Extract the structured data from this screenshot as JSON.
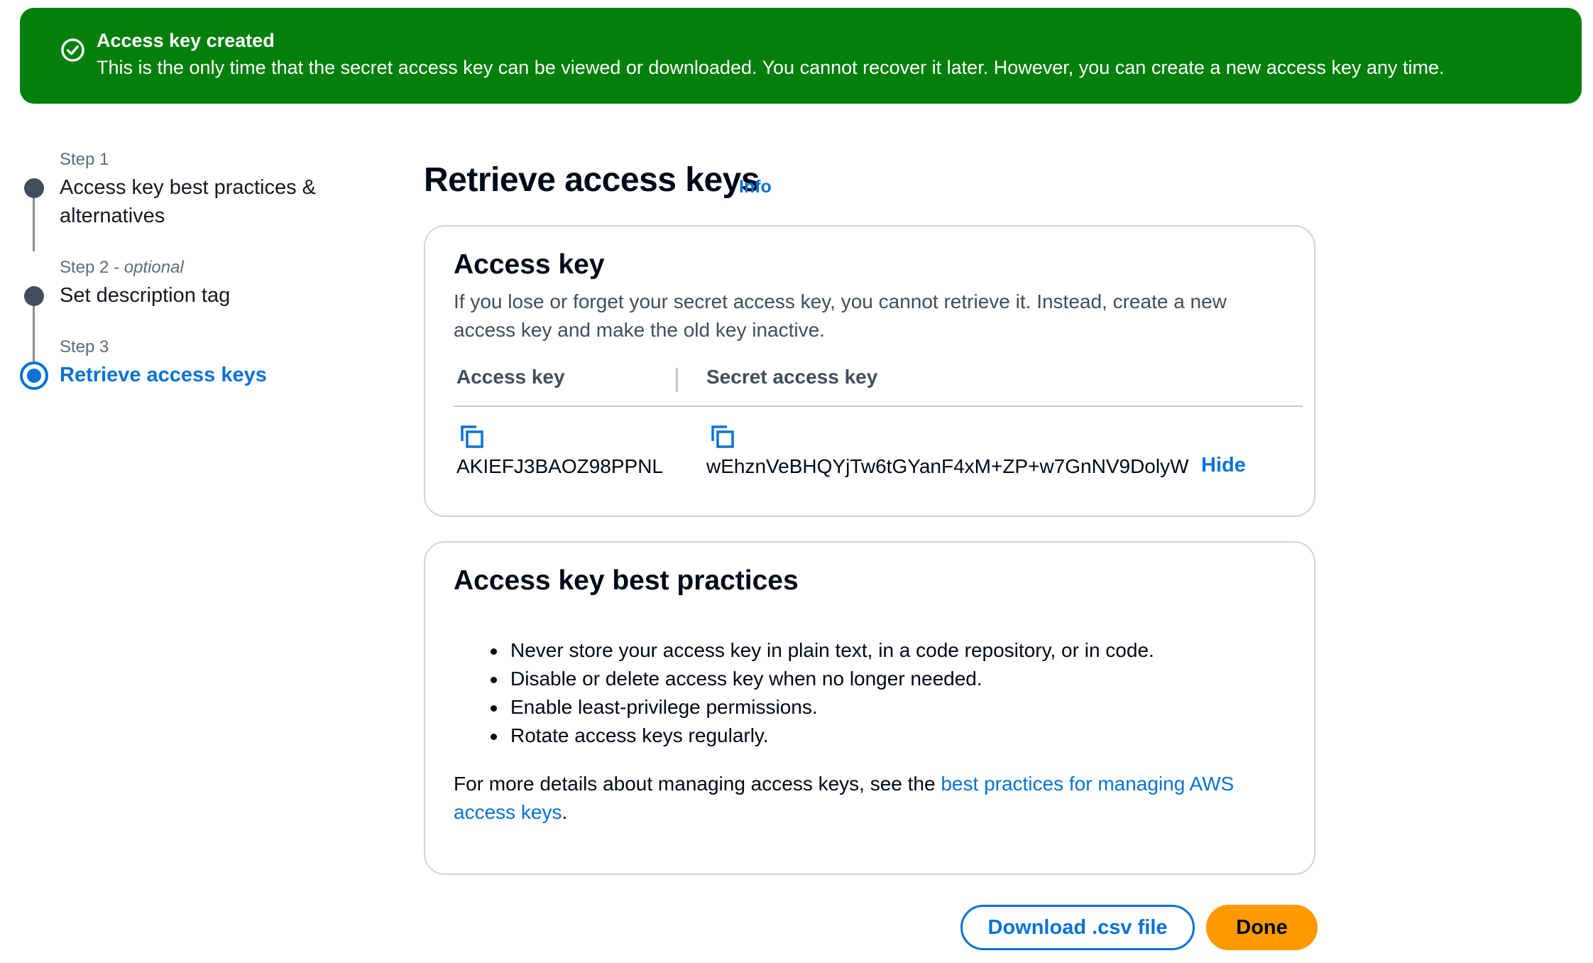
{
  "flash": {
    "icon": "check-circle-icon",
    "title": "Access key created",
    "message": "This is the only time that the secret access key can be viewed or downloaded. You cannot recover it later. However, you can create a new access key any time.",
    "color": "#037f0c"
  },
  "steps": [
    {
      "number": "Step 1",
      "optional": "",
      "title_line1": "Access key best practices &",
      "title_line2": "alternatives"
    },
    {
      "number": "Step 2",
      "optional": " - optional",
      "title_line1": "Set description tag"
    },
    {
      "number": "Step 3",
      "optional": "",
      "title_line1": "Retrieve access keys",
      "current": true
    }
  ],
  "header": {
    "title": "Retrieve access keys",
    "info_link": "Info"
  },
  "access_key_panel": {
    "title": "Access key",
    "description": "If you lose or forget your secret access key, you cannot retrieve it. Instead, create a new access key and make the old key inactive.",
    "columns": [
      "Access key",
      "Secret access key"
    ],
    "access_key_value": "AKIEFJ3BAOZ98PPNL",
    "secret_key_value": "wEhznVeBHQYjTw6tGYanF4xM+ZP+w7GnNV9DolyW",
    "hide_label": "Hide",
    "copy_icon": "copy-icon"
  },
  "best_practices": {
    "title": "Access key best practices",
    "items": [
      "Never store your access key in plain text, in a code repository, or in code.",
      "Disable or delete access key when no longer needed.",
      "Enable least-privilege permissions.",
      "Rotate access keys regularly."
    ],
    "footer_prefix": "For more details about managing access keys, see the ",
    "footer_link": "best practices for managing AWS access keys",
    "footer_suffix": "."
  },
  "actions": {
    "download_label": "Download .csv file",
    "done_label": "Done"
  },
  "colors": {
    "accent": "#0972d3",
    "primary_button": "#ff9900",
    "success": "#037f0c"
  }
}
